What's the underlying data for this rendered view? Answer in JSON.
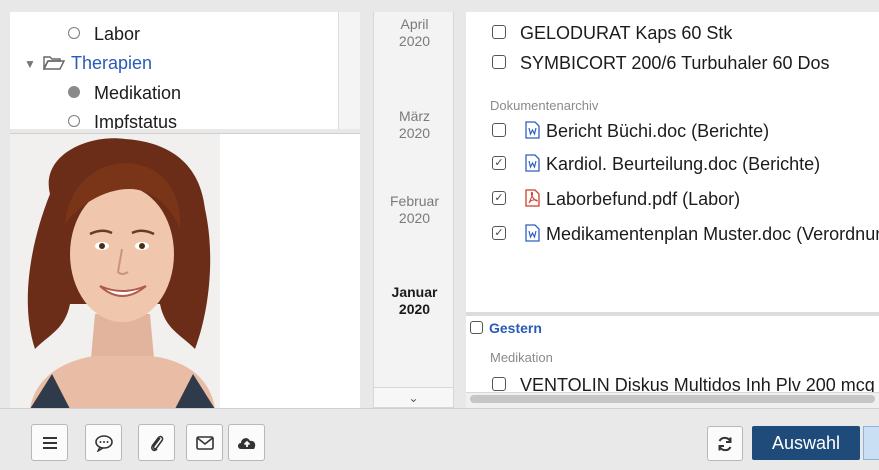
{
  "tree": {
    "items": [
      {
        "label": "Labor"
      },
      {
        "label": "Therapien"
      },
      {
        "label": "Medikation"
      },
      {
        "label": "Impfstatus"
      }
    ]
  },
  "timeline": {
    "months": [
      {
        "name": "April",
        "year": "2020"
      },
      {
        "name": "März",
        "year": "2020"
      },
      {
        "name": "Februar",
        "year": "2020"
      },
      {
        "name": "Januar",
        "year": "2020"
      }
    ]
  },
  "documents": {
    "items_top": [
      {
        "label": "GELODURAT Kaps 60 Stk",
        "checked": false
      },
      {
        "label": "SYMBICORT 200/6 Turbuhaler 60 Dos",
        "checked": false
      }
    ],
    "archive_label": "Dokumentenarchiv",
    "archive_items": [
      {
        "label": "Bericht Büchi.doc (Berichte)",
        "checked": false,
        "filetype": "word"
      },
      {
        "label": "Kardiol. Beurteilung.doc (Berichte)",
        "checked": true,
        "filetype": "word"
      },
      {
        "label": "Laborbefund.pdf (Labor)",
        "checked": true,
        "filetype": "pdf"
      },
      {
        "label": "Medikamentenplan Muster.doc (Verordnungen)",
        "checked": true,
        "filetype": "word"
      }
    ]
  },
  "section_two": {
    "header": "Gestern",
    "label": "Medikation",
    "item": "VENTOLIN Diskus Multidos Inh Plv 200 mcg"
  },
  "toolbar": {
    "icons": [
      "menu-icon",
      "comment-icon",
      "paperclip-icon",
      "mail-icon",
      "cloud-upload-icon",
      "refresh-icon"
    ],
    "auswahl_label": "Auswahl"
  },
  "colors": {
    "link": "#2a5ab8",
    "primary_button": "#1e4b7a",
    "pdf": "#d23b2f",
    "word": "#2f5fc4"
  }
}
